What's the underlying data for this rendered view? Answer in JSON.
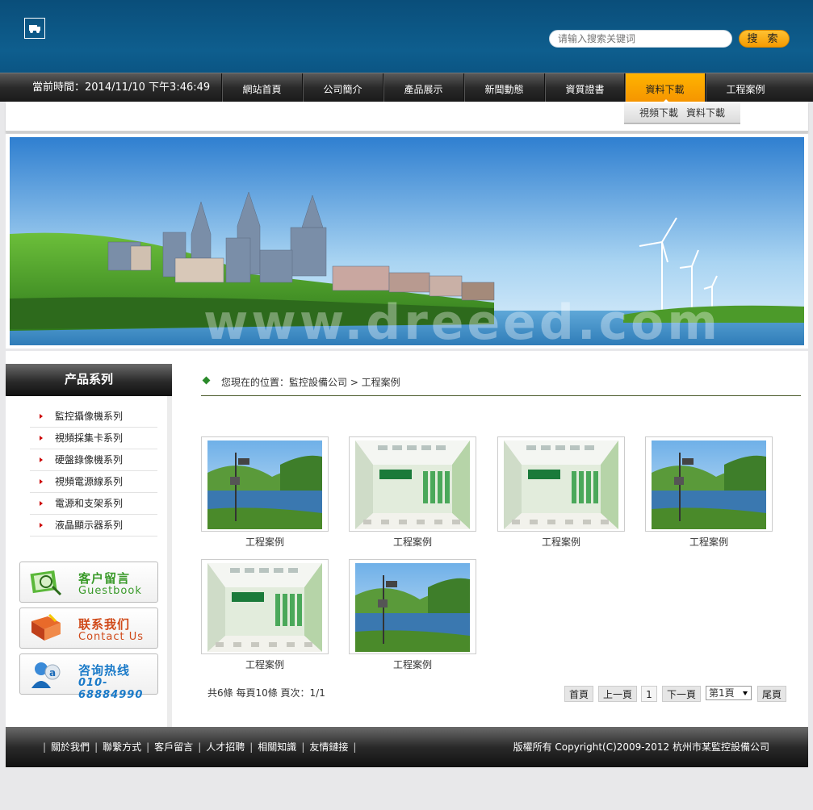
{
  "header": {
    "search_placeholder": "请输入搜索关键词",
    "search_button": "搜 索"
  },
  "nav": {
    "time_label": "當前時間：2014/11/10 下午3:46:49",
    "items": [
      "網站首頁",
      "公司簡介",
      "產品展示",
      "新聞動態",
      "資質證書",
      "資料下載",
      "工程案例"
    ],
    "active_index": 5
  },
  "subnav": {
    "items": [
      "視頻下載",
      "資料下載"
    ]
  },
  "sidebar": {
    "title": "产品系列",
    "items": [
      "監控攝像機系列",
      "視頻採集卡系列",
      "硬盤錄像機系列",
      "視頻電源線系列",
      "電源和支架系列",
      "液晶顯示器系列"
    ],
    "promos": [
      {
        "title": "客户留言",
        "subtitle": "Guestbook",
        "color": "#3a9a2a"
      },
      {
        "title": "联系我们",
        "subtitle": "Contact Us",
        "color": "#d04a1a"
      },
      {
        "title": "咨询热线",
        "subtitle": "010-68884990",
        "color": "#1a7ac8"
      }
    ]
  },
  "content": {
    "breadcrumb": "您現在的位置：監控設備公司 > 工程案例",
    "cases": [
      {
        "label": "工程案例",
        "image": "lake-camera"
      },
      {
        "label": "工程案例",
        "image": "bank-hall"
      },
      {
        "label": "工程案例",
        "image": "bank-hall"
      },
      {
        "label": "工程案例",
        "image": "lake-camera"
      },
      {
        "label": "工程案例",
        "image": "bank-hall"
      },
      {
        "label": "工程案例",
        "image": "lake-camera"
      }
    ],
    "pagination": {
      "info": "共6條 每頁10條 頁次：1/1",
      "first": "首頁",
      "prev": "上一頁",
      "current": "1",
      "next": "下一頁",
      "select": "第1頁",
      "last": "尾頁"
    }
  },
  "footer": {
    "links": [
      "關於我們",
      "聯繫方式",
      "客戶留言",
      "人才招聘",
      "相關知識",
      "友情鏈接"
    ],
    "copyright": "版權所有 Copyright(C)2009-2012 杭州市某監控設備公司"
  }
}
